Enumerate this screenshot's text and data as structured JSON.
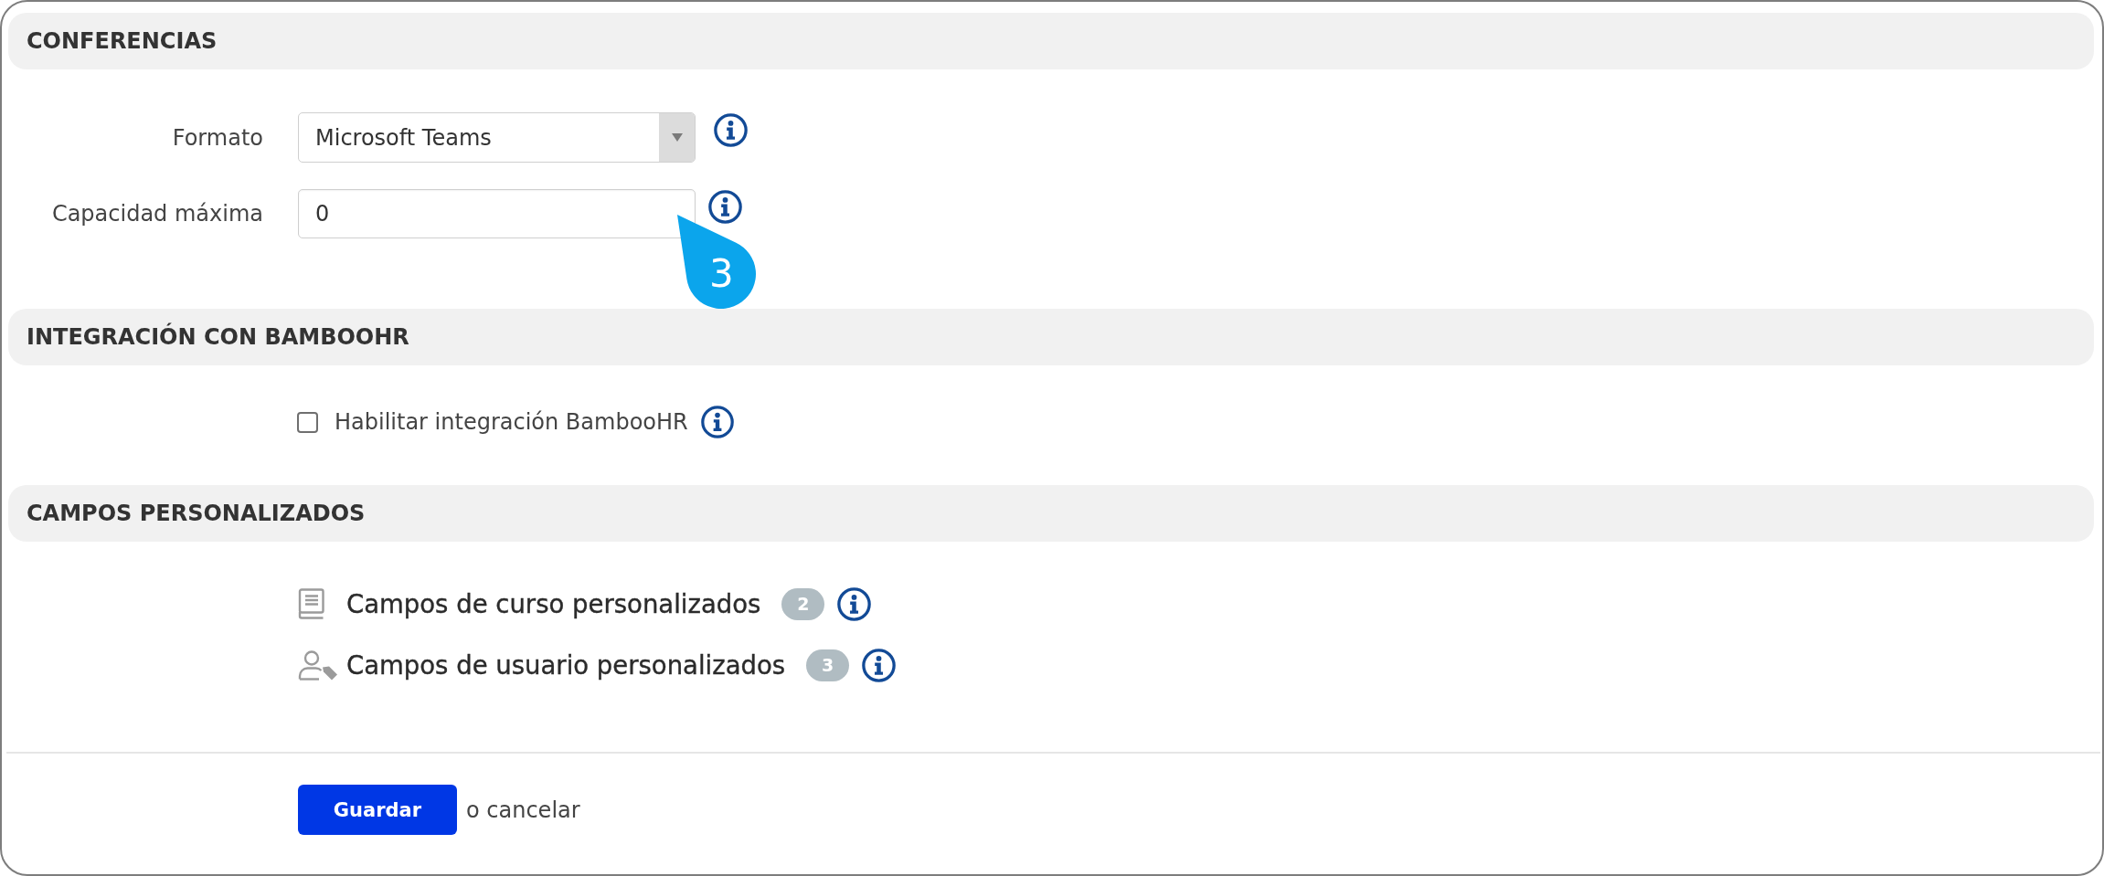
{
  "sections": [
    {
      "title": "CONFERENCIAS",
      "kind": "fields",
      "fields": [
        {
          "label": "Formato",
          "kind": "select",
          "value": "Microsoft Teams"
        },
        {
          "label": "Capacidad máxima",
          "kind": "text",
          "value": "0"
        }
      ]
    },
    {
      "title": "INTEGRACIÓN CON BAMBOOHR",
      "kind": "checkboxes",
      "options": [
        {
          "label": "Habilitar integración BambooHR",
          "checked": false
        }
      ]
    },
    {
      "title": "CAMPOS PERSONALIZADOS",
      "kind": "links",
      "links": [
        {
          "label": "Campos de curso personalizados",
          "kind": "course",
          "count": "2"
        },
        {
          "label": "Campos de usuario personalizados",
          "kind": "user",
          "count": "3"
        }
      ]
    }
  ],
  "callout": {
    "label": "3"
  },
  "footer": {
    "save": "Guardar",
    "cancel": "o cancelar"
  }
}
